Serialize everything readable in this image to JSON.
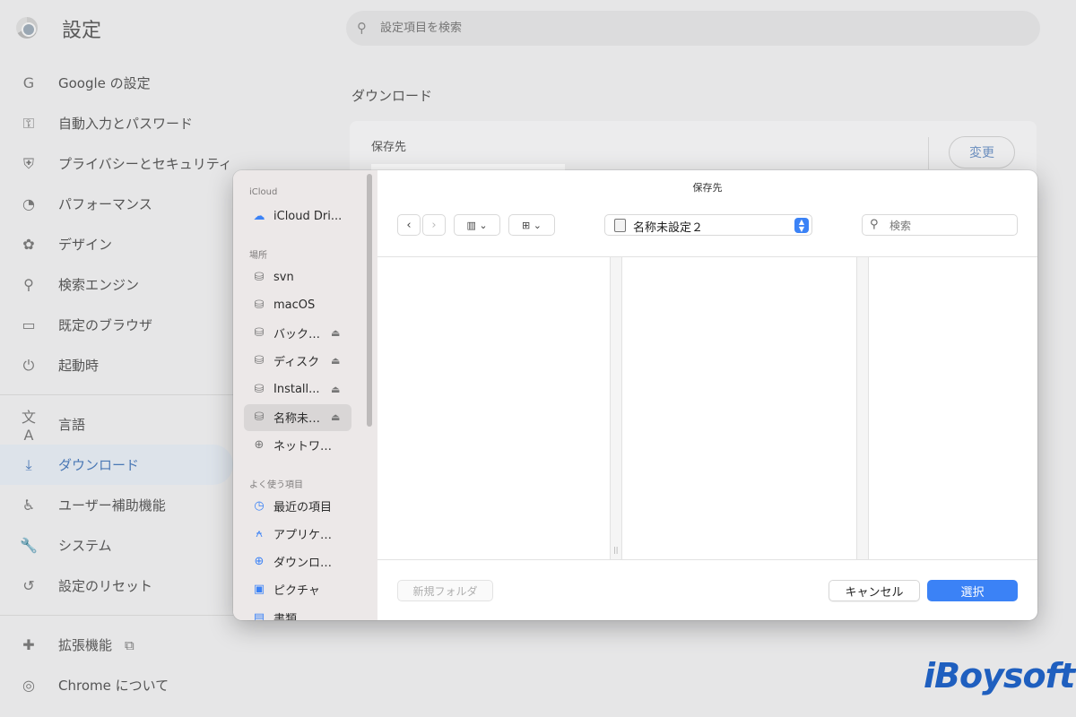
{
  "settings": {
    "title": "設定",
    "search_placeholder": "設定項目を検索",
    "nav_group1": [
      {
        "icon": "G",
        "label": "Google の設定"
      },
      {
        "icon": "⚿",
        "label": "自動入力とパスワード"
      },
      {
        "icon": "⛨",
        "label": "プライバシーとセキュリティ"
      },
      {
        "icon": "◔",
        "label": "パフォーマンス"
      },
      {
        "icon": "✿",
        "label": "デザイン"
      },
      {
        "icon": "⚲",
        "label": "検索エンジン"
      },
      {
        "icon": "▭",
        "label": "既定のブラウザ"
      },
      {
        "icon": "⏻",
        "label": "起動時"
      }
    ],
    "nav_group2": [
      {
        "icon": "文A",
        "label": "言語"
      },
      {
        "icon": "⤓",
        "label": "ダウンロード"
      },
      {
        "icon": "♿",
        "label": "ユーザー補助機能"
      },
      {
        "icon": "🔧",
        "label": "システム"
      },
      {
        "icon": "↺",
        "label": "設定のリセット"
      }
    ],
    "nav_group3": [
      {
        "icon": "✚",
        "label": "拡張機能",
        "extra": "⧉"
      },
      {
        "icon": "◎",
        "label": "Chrome について"
      }
    ],
    "section_title": "ダウンロード",
    "download_location_label": "保存先",
    "change_button": "変更",
    "active_item": "ダウンロード"
  },
  "dialog": {
    "title": "保存先",
    "sidebar": {
      "icloud_header": "iCloud",
      "icloud_items": [
        {
          "icon": "cloud-icon",
          "label": "iCloud Dri..."
        }
      ],
      "locations_header": "場所",
      "location_items": [
        {
          "icon": "drive-icon",
          "label": "svn",
          "eject": false
        },
        {
          "icon": "drive-icon",
          "label": "macOS",
          "eject": false
        },
        {
          "icon": "drive-icon",
          "label": "バック…",
          "eject": true
        },
        {
          "icon": "drive-icon",
          "label": "ディスク",
          "eject": true
        },
        {
          "icon": "drive-icon",
          "label": "Install...",
          "eject": true
        },
        {
          "icon": "drive-icon",
          "label": "名称未…",
          "eject": true
        },
        {
          "icon": "globe-icon",
          "label": "ネットワ…",
          "eject": false
        }
      ],
      "favorites_header": "よく使う項目",
      "favorite_items": [
        {
          "icon": "clock-icon",
          "label": "最近の項目"
        },
        {
          "icon": "apps-icon",
          "label": "アプリケ…"
        },
        {
          "icon": "download-icon",
          "label": "ダウンロ…"
        },
        {
          "icon": "photo-icon",
          "label": "ピクチャ"
        },
        {
          "icon": "document-icon",
          "label": "書類"
        }
      ]
    },
    "path_label": "名称未設定２",
    "search_placeholder": "検索",
    "new_folder_button": "新規フォルダ",
    "cancel_button": "キャンセル",
    "select_button": "選択"
  },
  "watermark": "iBoysoft",
  "colors": {
    "accent_blue": "#3b82f6",
    "chrome_active": "#4a78b5",
    "watermark": "#1f5fbf"
  }
}
